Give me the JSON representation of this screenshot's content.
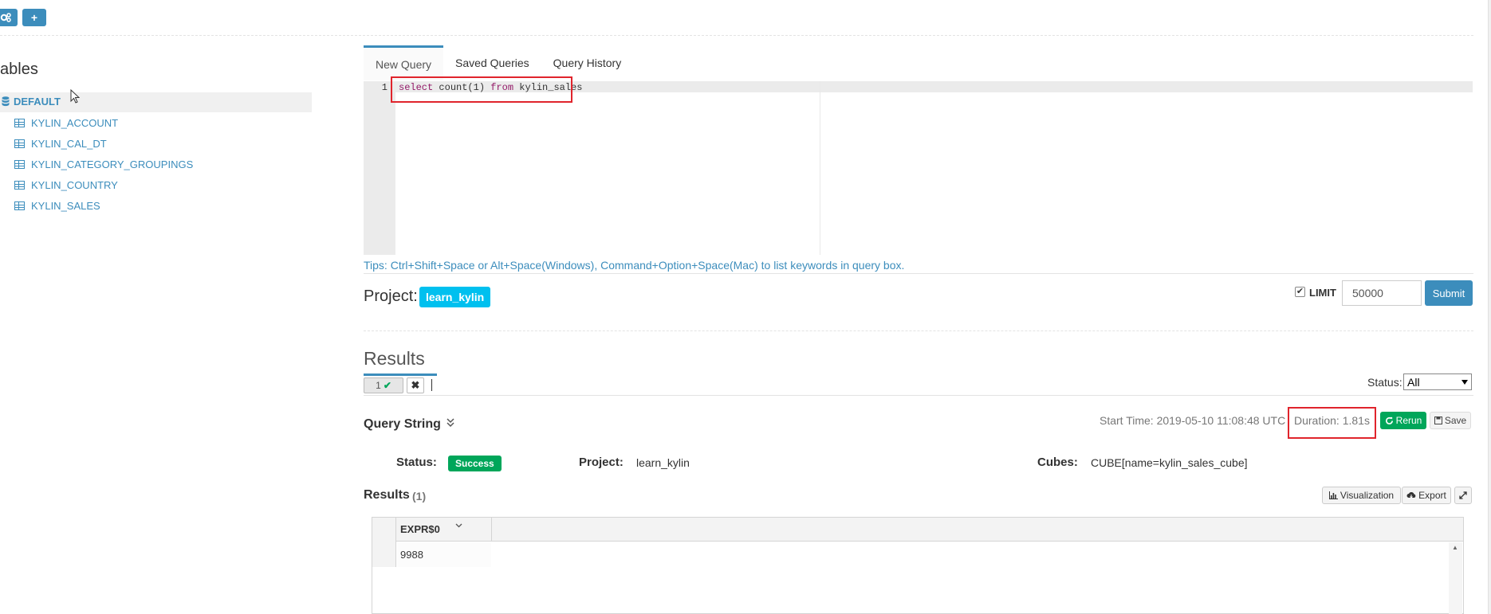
{
  "toolbar": {
    "gear_icon": "gears-icon",
    "plus_label": "+"
  },
  "sidebar": {
    "title": "ables",
    "database": "DEFAULT",
    "tables": [
      "KYLIN_ACCOUNT",
      "KYLIN_CAL_DT",
      "KYLIN_CATEGORY_GROUPINGS",
      "KYLIN_COUNTRY",
      "KYLIN_SALES"
    ]
  },
  "tabs": [
    "New Query",
    "Saved Queries",
    "Query History"
  ],
  "editor": {
    "line_number": "1",
    "kw_select": "select",
    "fn_count": " count(1) ",
    "kw_from": "from",
    "table": " kylin_sales"
  },
  "tips": "Tips: Ctrl+Shift+Space or Alt+Space(Windows), Command+Option+Space(Mac) to list keywords in query box.",
  "project": {
    "label": "Project:",
    "name": "learn_kylin"
  },
  "limit": {
    "checkbox": "✔",
    "label": "LIMIT",
    "value": "50000"
  },
  "submit_label": "Submit",
  "results": {
    "title": "Results",
    "tab_number": "1",
    "tab_check": "✔",
    "close": "✖",
    "status_filter_label": "Status:",
    "status_filter_value": "All"
  },
  "query_string": {
    "title": "Query String",
    "start_time": "Start Time: 2019-05-10 11:08:48 UTC",
    "duration": "Duration: 1.81s",
    "rerun_label": "Rerun",
    "save_label": "Save",
    "status_label": "Status:",
    "status_value": "Success",
    "project_label": "Project:",
    "project_value": "learn_kylin",
    "cubes_label": "Cubes:",
    "cubes_value": "CUBE[name=kylin_sales_cube]"
  },
  "result_table": {
    "title": "Results",
    "count": "(1)",
    "visualization_label": "Visualization",
    "export_label": "Export",
    "columns": [
      "EXPR$0"
    ],
    "rows": [
      [
        "9988"
      ]
    ]
  },
  "colors": {
    "primary": "#3c8dbc",
    "success": "#00a65a",
    "info": "#00c0ef",
    "highlight": "#e0242c"
  }
}
